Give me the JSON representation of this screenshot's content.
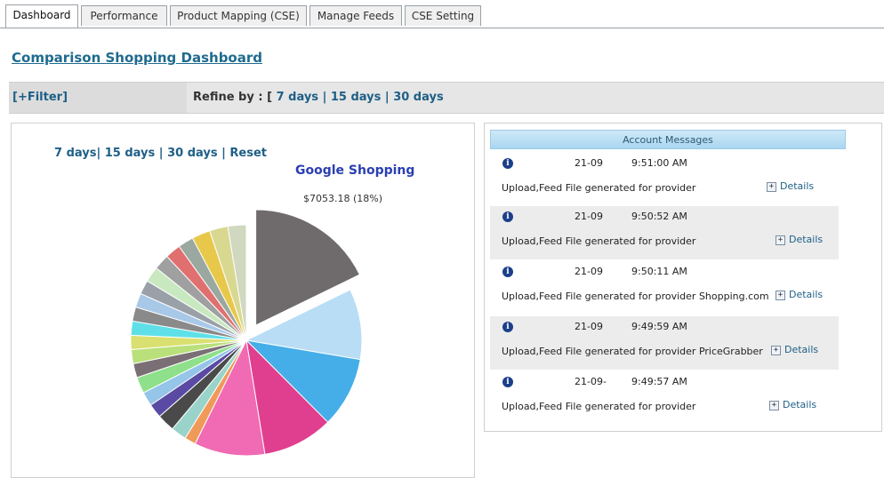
{
  "tabs": [
    {
      "label": "Dashboard",
      "active": true
    },
    {
      "label": "Performance",
      "active": false
    },
    {
      "label": "Product Mapping (CSE)",
      "active": false
    },
    {
      "label": "Manage Feeds",
      "active": false
    },
    {
      "label": "CSE Setting",
      "active": false
    }
  ],
  "page_title": "Comparison Shopping Dashboard",
  "filterbar": {
    "filter_label": "[+Filter]",
    "refine_label": "Refine by : [",
    "options": [
      "7 days",
      "15 days",
      "30 days"
    ]
  },
  "chart": {
    "range_links": [
      "7 days",
      "15 days",
      "30 days",
      "Reset"
    ],
    "highlight_title": "Google Shopping",
    "highlight_label": "$7053.18 (18%)"
  },
  "chart_data": {
    "type": "pie",
    "exploded_slice": "Google Shopping",
    "slices": [
      {
        "name": "Google Shopping",
        "value": 18,
        "color": "#6f6b6d"
      },
      {
        "value": 10,
        "color": "#b9ddf4"
      },
      {
        "value": 10,
        "color": "#45aee8"
      },
      {
        "value": 10,
        "color": "#e03f8f"
      },
      {
        "value": 10,
        "color": "#f06ab4"
      },
      {
        "value": 1.6,
        "color": "#f09a5a"
      },
      {
        "value": 2.2,
        "color": "#9ad3c9"
      },
      {
        "value": 2.5,
        "color": "#4a4a4a"
      },
      {
        "value": 2.0,
        "color": "#5a4aa3"
      },
      {
        "value": 2.0,
        "color": "#95c5e8"
      },
      {
        "value": 2.3,
        "color": "#8ee08a"
      },
      {
        "value": 2.0,
        "color": "#7a6f74"
      },
      {
        "value": 2.0,
        "color": "#b9e07a"
      },
      {
        "value": 2.0,
        "color": "#d9e070"
      },
      {
        "value": 2.0,
        "color": "#5fe0e8"
      },
      {
        "value": 2.0,
        "color": "#8a8a8a"
      },
      {
        "value": 2.0,
        "color": "#a8c8e8"
      },
      {
        "value": 2.0,
        "color": "#9aa0a8"
      },
      {
        "value": 2.2,
        "color": "#c8e8c0"
      },
      {
        "value": 2.2,
        "color": "#a0a0a0"
      },
      {
        "value": 2.2,
        "color": "#e07070"
      },
      {
        "value": 2.2,
        "color": "#9aa8a0"
      },
      {
        "value": 2.6,
        "color": "#e8c84a"
      },
      {
        "value": 2.6,
        "color": "#d8d890"
      },
      {
        "value": 2.6,
        "color": "#d0d8c0"
      }
    ]
  },
  "messages": {
    "header": "Account Messages",
    "items": [
      {
        "date": "21-09",
        "time": "9:51:00 AM",
        "text": "Upload,Feed File generated for provider",
        "details": "Details"
      },
      {
        "date": "21-09",
        "time": "9:50:52 AM",
        "text": "Upload,Feed File generated for provider",
        "details": "Details"
      },
      {
        "date": "21-09",
        "time": "9:50:11 AM",
        "text": "Upload,Feed File generated for provider Shopping.com",
        "details": "Details"
      },
      {
        "date": "21-09",
        "time": "9:49:59 AM",
        "text": "Upload,Feed File generated for provider PriceGrabber",
        "details": "Details"
      },
      {
        "date": "21-09-",
        "time": "9:49:57 AM",
        "text": "Upload,Feed File generated for provider",
        "details": "Details"
      }
    ]
  }
}
